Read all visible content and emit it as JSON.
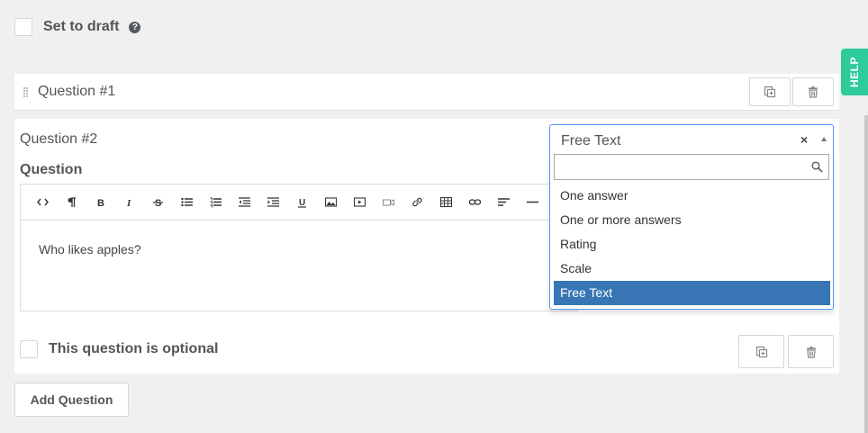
{
  "draft": {
    "label": "Set to draft",
    "help_glyph": "?",
    "checked": false
  },
  "help_tab": {
    "label": "HELP"
  },
  "questions": [
    {
      "title": "Question #1"
    },
    {
      "title": "Question #2",
      "question_label": "Question",
      "body_text": "Who likes apples?",
      "optional_label": "This question is optional",
      "optional_checked": false
    }
  ],
  "toolbar": {
    "items": [
      {
        "name": "code-view-icon",
        "glyph": "<>"
      },
      {
        "name": "paragraph-icon",
        "glyph": "¶"
      },
      {
        "name": "bold-icon",
        "glyph": "B"
      },
      {
        "name": "italic-icon",
        "glyph": "I"
      },
      {
        "name": "strikethrough-icon",
        "glyph": "S"
      },
      {
        "name": "bullet-list-icon",
        "glyph": "ul"
      },
      {
        "name": "numbered-list-icon",
        "glyph": "ol"
      },
      {
        "name": "outdent-icon",
        "glyph": "out"
      },
      {
        "name": "indent-icon",
        "glyph": "in"
      },
      {
        "name": "underline-icon",
        "glyph": "U"
      },
      {
        "name": "image-icon",
        "glyph": "img"
      },
      {
        "name": "video-icon",
        "glyph": "vid"
      },
      {
        "name": "camera-icon",
        "glyph": "cam"
      },
      {
        "name": "link-icon",
        "glyph": "link"
      },
      {
        "name": "table-icon",
        "glyph": "tbl"
      },
      {
        "name": "chain-link-icon",
        "glyph": "chain"
      },
      {
        "name": "align-icon",
        "glyph": "align"
      },
      {
        "name": "horizontal-rule-icon",
        "glyph": "hr"
      }
    ]
  },
  "select": {
    "value": "Free Text",
    "clear_glyph": "×",
    "search_placeholder": "",
    "options": [
      {
        "label": "One answer",
        "selected": false
      },
      {
        "label": "One or more answers",
        "selected": false
      },
      {
        "label": "Rating",
        "selected": false
      },
      {
        "label": "Scale",
        "selected": false
      },
      {
        "label": "Free Text",
        "selected": true
      }
    ]
  },
  "add_question": {
    "label": "Add Question"
  },
  "colors": {
    "help_tab": "#2ecc9a",
    "selected_option": "#3875b4",
    "focus_border": "#5897fb"
  }
}
